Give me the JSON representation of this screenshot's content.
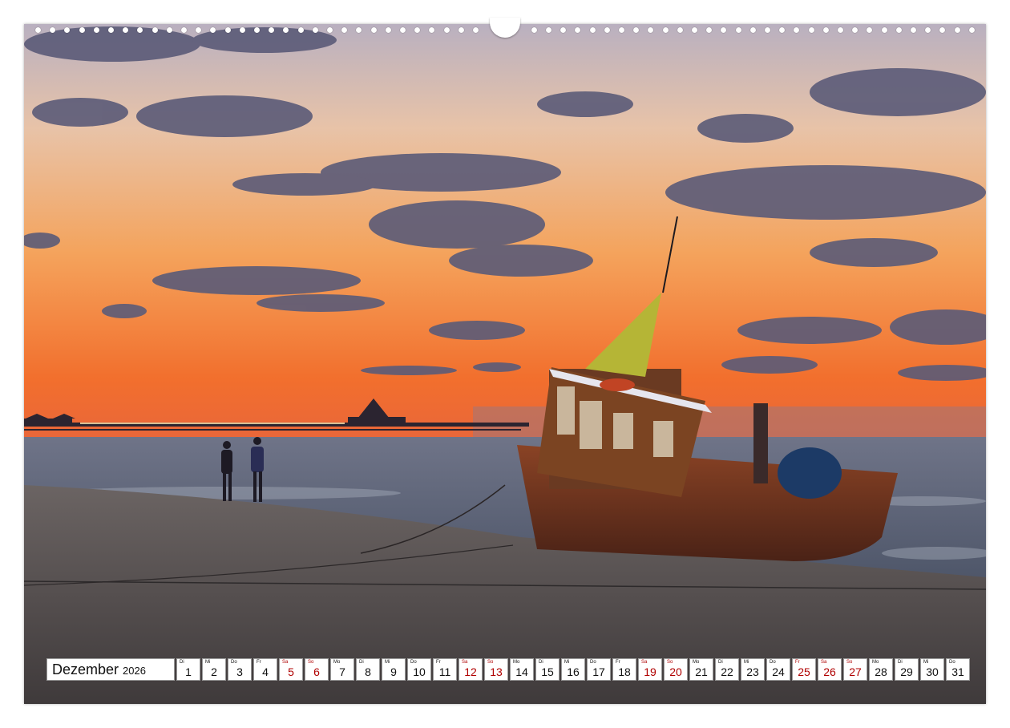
{
  "calendar": {
    "month": "Dezember",
    "year": "2026",
    "weekend_color": "#b00000",
    "days": [
      {
        "wd": "Di",
        "num": "1",
        "weekend": false
      },
      {
        "wd": "Mi",
        "num": "2",
        "weekend": false
      },
      {
        "wd": "Do",
        "num": "3",
        "weekend": false
      },
      {
        "wd": "Fr",
        "num": "4",
        "weekend": false
      },
      {
        "wd": "Sa",
        "num": "5",
        "weekend": true
      },
      {
        "wd": "So",
        "num": "6",
        "weekend": true
      },
      {
        "wd": "Mo",
        "num": "7",
        "weekend": false
      },
      {
        "wd": "Di",
        "num": "8",
        "weekend": false
      },
      {
        "wd": "Mi",
        "num": "9",
        "weekend": false
      },
      {
        "wd": "Do",
        "num": "10",
        "weekend": false
      },
      {
        "wd": "Fr",
        "num": "11",
        "weekend": false
      },
      {
        "wd": "Sa",
        "num": "12",
        "weekend": true
      },
      {
        "wd": "So",
        "num": "13",
        "weekend": true
      },
      {
        "wd": "Mo",
        "num": "14",
        "weekend": false
      },
      {
        "wd": "Di",
        "num": "15",
        "weekend": false
      },
      {
        "wd": "Mi",
        "num": "16",
        "weekend": false
      },
      {
        "wd": "Do",
        "num": "17",
        "weekend": false
      },
      {
        "wd": "Fr",
        "num": "18",
        "weekend": false
      },
      {
        "wd": "Sa",
        "num": "19",
        "weekend": true
      },
      {
        "wd": "So",
        "num": "20",
        "weekend": true
      },
      {
        "wd": "Mo",
        "num": "21",
        "weekend": false
      },
      {
        "wd": "Di",
        "num": "22",
        "weekend": false
      },
      {
        "wd": "Mi",
        "num": "23",
        "weekend": false
      },
      {
        "wd": "Do",
        "num": "24",
        "weekend": false
      },
      {
        "wd": "Fr",
        "num": "25",
        "weekend": true
      },
      {
        "wd": "Sa",
        "num": "26",
        "weekend": true
      },
      {
        "wd": "So",
        "num": "27",
        "weekend": true
      },
      {
        "wd": "Mo",
        "num": "28",
        "weekend": false
      },
      {
        "wd": "Di",
        "num": "29",
        "weekend": false
      },
      {
        "wd": "Mi",
        "num": "30",
        "weekend": false
      },
      {
        "wd": "Do",
        "num": "31",
        "weekend": false
      }
    ]
  },
  "photo": {
    "palette": {
      "sky_top": "#c9b7b8",
      "sky_mid": "#f2a15e",
      "sky_low": "#f26a2c",
      "sea": "#5d6678",
      "sand": "#56504f",
      "boat_hull": "#6e3320",
      "flag": "#b5b536",
      "cloud": "#5a5a78"
    }
  }
}
